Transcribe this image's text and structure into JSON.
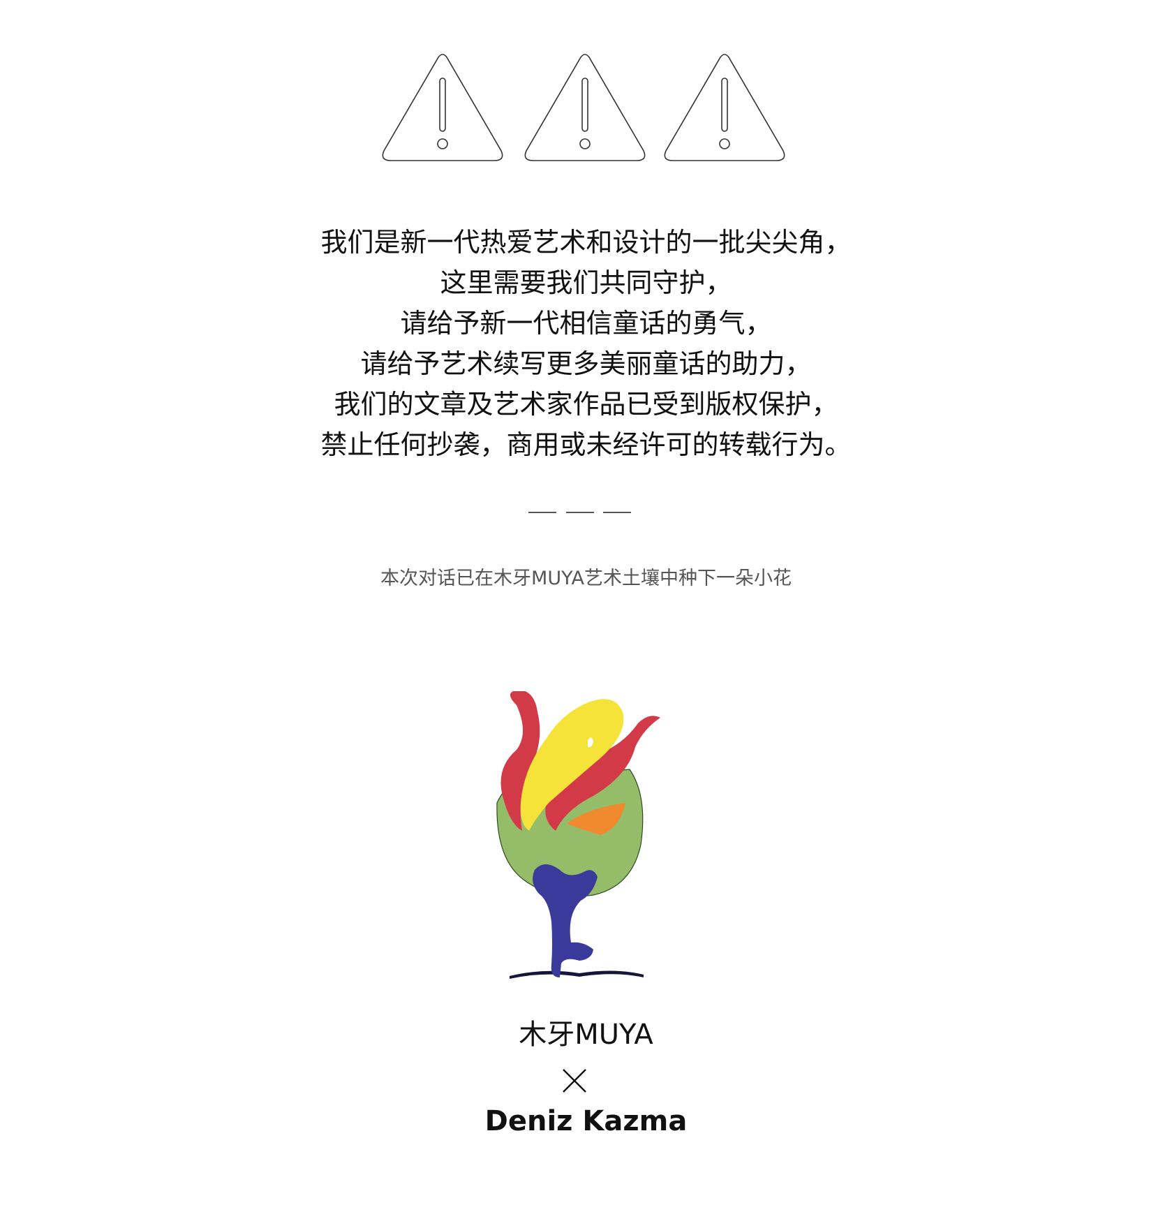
{
  "warning_icons": [
    "warning-triangle-icon",
    "warning-triangle-icon",
    "warning-triangle-icon"
  ],
  "statement": {
    "lines": [
      "我们是新一代热爱艺术和设计的一批尖尖角，",
      "这里需要我们共同守护，",
      "请给予新一代相信童话的勇气，",
      "请给予艺术续写更多美丽童话的助力，",
      "我们的文章及艺术家作品已受到版权保护，",
      "禁止任何抄袭，商用或未经许可的转载行为。"
    ]
  },
  "divider_icon": "triple-dash-divider",
  "caption": "本次对话已在木牙MUYA艺术土壤中种下一朵小花",
  "logo": {
    "icon": "flower-tree-logo-icon",
    "colors": {
      "red": "#d23a47",
      "yellow": "#f6e33a",
      "green": "#95bc68",
      "orange": "#f1892e",
      "blue": "#3a3a9a",
      "ground": "#16163a"
    }
  },
  "brand_name": "木牙MUYA",
  "cross_icon": "cross-icon",
  "artist_name": "Deniz Kazma",
  "colors": {
    "text": "#111111",
    "caption": "#555555",
    "icon_stroke": "#333333",
    "background": "#ffffff"
  }
}
